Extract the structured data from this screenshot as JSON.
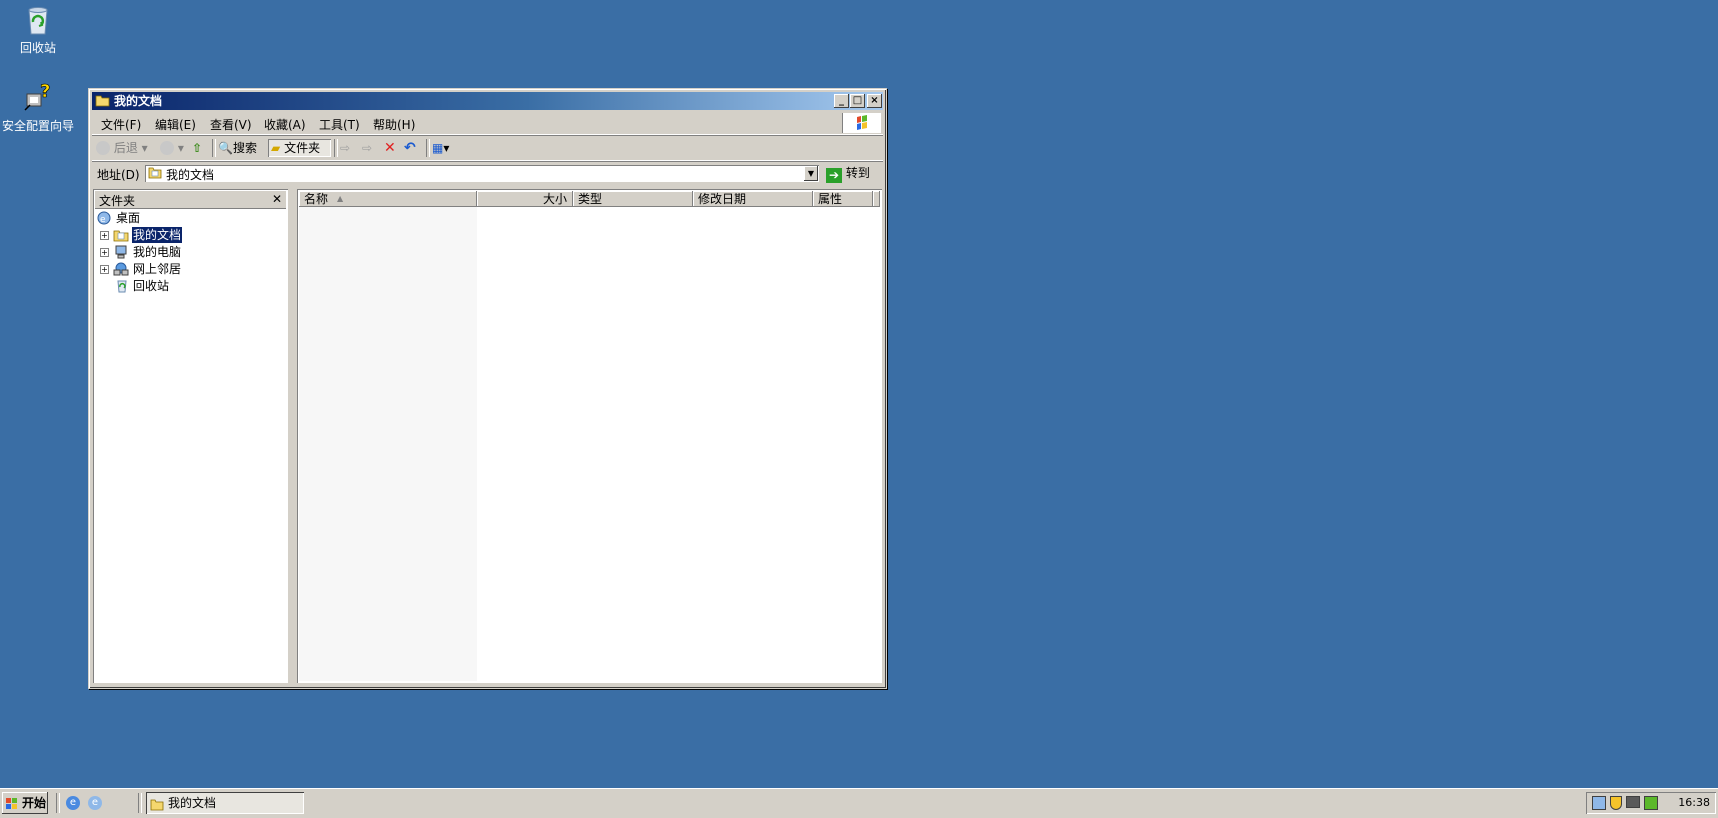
{
  "desktop": {
    "icons": [
      {
        "label": "回收站",
        "icon": "recycle-bin-icon"
      },
      {
        "label": "安全配置向导",
        "icon": "security-wizard-icon"
      }
    ]
  },
  "window": {
    "title": "我的文档",
    "menu": [
      "文件(F)",
      "编辑(E)",
      "查看(V)",
      "收藏(A)",
      "工具(T)",
      "帮助(H)"
    ],
    "toolbar": {
      "back": "后退",
      "search": "搜索",
      "folders": "文件夹"
    },
    "address": {
      "label": "地址(D)",
      "value": "我的文档",
      "go": "转到"
    },
    "folder_pane": {
      "title": "文件夹",
      "close": "✕",
      "tree": [
        {
          "label": "桌面",
          "icon": "desktop-icon",
          "level": 0,
          "expandable": false,
          "selected": false
        },
        {
          "label": "我的文档",
          "icon": "my-documents-icon",
          "level": 1,
          "expandable": true,
          "selected": true
        },
        {
          "label": "我的电脑",
          "icon": "my-computer-icon",
          "level": 1,
          "expandable": true,
          "selected": false
        },
        {
          "label": "网上邻居",
          "icon": "network-places-icon",
          "level": 1,
          "expandable": true,
          "selected": false
        },
        {
          "label": "回收站",
          "icon": "recycle-bin-icon",
          "level": 1,
          "expandable": false,
          "selected": false
        }
      ]
    },
    "columns": [
      "名称",
      "大小",
      "类型",
      "修改日期",
      "属性"
    ],
    "items": []
  },
  "taskbar": {
    "start": "开始",
    "task": "我的文档",
    "clock": "16:38"
  },
  "colors": {
    "desktop": "#3a6ea5",
    "title_start": "#0a246a",
    "title_end": "#a6caf0",
    "face": "#d4d0c8",
    "selection": "#0a246a"
  }
}
